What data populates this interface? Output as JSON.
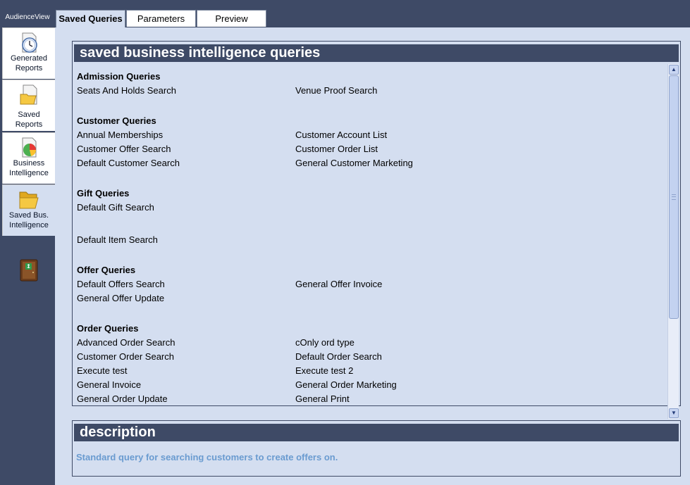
{
  "app": {
    "title": "AudienceView"
  },
  "sidebar": {
    "items": [
      {
        "label_line1": "Generated",
        "label_line2": "Reports",
        "icon": "clock-icon"
      },
      {
        "label_line1": "Saved Reports",
        "label_line2": "",
        "icon": "folder-document-icon"
      },
      {
        "label_line1": "Business",
        "label_line2": "Intelligence",
        "icon": "pie-chart-icon"
      },
      {
        "label_line1": "Saved Bus.",
        "label_line2": "Intelligence",
        "icon": "open-folder-icon",
        "selected": true
      }
    ],
    "exit_icon": "exit-door-icon"
  },
  "tabs": [
    {
      "label": "Saved Queries",
      "active": true
    },
    {
      "label": "Parameters"
    },
    {
      "label": "Preview"
    }
  ],
  "queries": {
    "header": "saved business intelligence queries",
    "groups": [
      {
        "title": "Admission Queries",
        "items": [
          "Seats And Holds Search",
          "Venue Proof Search"
        ]
      },
      {
        "title": "Customer Queries",
        "items": [
          "Annual Memberships",
          "Customer Account List",
          "Customer Offer Search",
          "Customer Order List",
          "Default Customer Search",
          "General Customer Marketing"
        ]
      },
      {
        "title": "Gift Queries",
        "items": [
          "Default Gift Search"
        ]
      },
      {
        "title": "",
        "items": [
          "Default Item Search"
        ]
      },
      {
        "title": "Offer Queries",
        "items": [
          "Default Offers Search",
          "General Offer Invoice",
          "General Offer Update"
        ]
      },
      {
        "title": "Order Queries",
        "items": [
          "Advanced Order Search",
          "cOnly ord type",
          "Customer Order Search",
          "Default Order Search",
          "Execute test",
          "Execute test 2",
          "General Invoice",
          "General Order Marketing",
          "General Order Update",
          "General Print"
        ]
      }
    ]
  },
  "description": {
    "header": "description",
    "text": "Standard query for searching customers to create offers on."
  },
  "colors": {
    "frame": "#3e4a66",
    "panel_bg": "#d4def0",
    "description_text": "#6a9bd0"
  }
}
